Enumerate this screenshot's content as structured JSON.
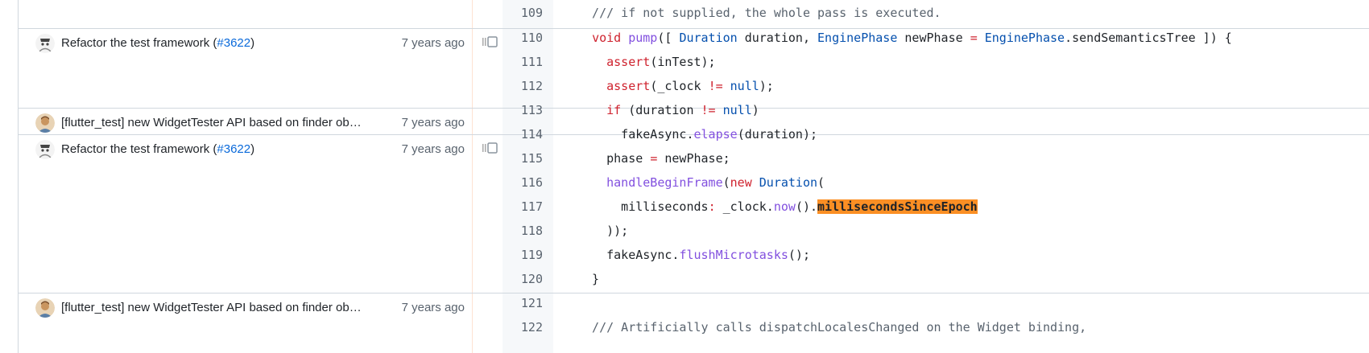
{
  "colors": {
    "keyword": "#cf222e",
    "type": "#0550ae",
    "function": "#8250df",
    "comment": "#59636e",
    "search_highlight": "#fb8f24",
    "link": "#0969da"
  },
  "blame": [
    {
      "message": "Refactor the test framework (",
      "pr": "#3622",
      "suffix": ")",
      "age": "7 years ago",
      "avatar": "ghost-avatar",
      "reblame": true
    },
    {
      "message": "[flutter_test] new WidgetTester API based on finder ob…",
      "pr": "",
      "suffix": "",
      "age": "7 years ago",
      "avatar": "person-avatar",
      "reblame": false
    },
    {
      "message": "Refactor the test framework (",
      "pr": "#3622",
      "suffix": ")",
      "age": "7 years ago",
      "avatar": "ghost-avatar",
      "reblame": true
    },
    {
      "message": "[flutter_test] new WidgetTester API based on finder ob…",
      "pr": "",
      "suffix": "",
      "age": "7 years ago",
      "avatar": "person-avatar",
      "reblame": false
    }
  ],
  "lines": [
    {
      "number": "109",
      "tokens": [
        [
          "  /// if not supplied, the whole pass is executed.",
          "cm"
        ]
      ]
    },
    {
      "number": "110",
      "tokens": [
        [
          "  ",
          ""
        ],
        [
          "void",
          "kw"
        ],
        [
          " ",
          ""
        ],
        [
          "pump",
          "fn"
        ],
        [
          "([ ",
          ""
        ],
        [
          "Duration",
          "ty"
        ],
        [
          " duration, ",
          ""
        ],
        [
          "EnginePhase",
          "ty"
        ],
        [
          " newPhase ",
          ""
        ],
        [
          "=",
          "kw"
        ],
        [
          " ",
          ""
        ],
        [
          "EnginePhase",
          "ty"
        ],
        [
          ".sendSemanticsTree ]) {",
          ""
        ]
      ]
    },
    {
      "number": "111",
      "tokens": [
        [
          "    ",
          ""
        ],
        [
          "assert",
          "kw"
        ],
        [
          "(inTest);",
          ""
        ]
      ]
    },
    {
      "number": "112",
      "tokens": [
        [
          "    ",
          ""
        ],
        [
          "assert",
          "kw"
        ],
        [
          "(_clock ",
          ""
        ],
        [
          "!=",
          "kw"
        ],
        [
          " ",
          ""
        ],
        [
          "null",
          "ty"
        ],
        [
          ");",
          ""
        ]
      ]
    },
    {
      "number": "113",
      "tokens": [
        [
          "    ",
          ""
        ],
        [
          "if",
          "kw"
        ],
        [
          " (duration ",
          ""
        ],
        [
          "!=",
          "kw"
        ],
        [
          " ",
          ""
        ],
        [
          "null",
          "ty"
        ],
        [
          ")",
          ""
        ]
      ]
    },
    {
      "number": "114",
      "tokens": [
        [
          "      fakeAsync.",
          ""
        ],
        [
          "elapse",
          "fn"
        ],
        [
          "(duration);",
          ""
        ]
      ]
    },
    {
      "number": "115",
      "tokens": [
        [
          "    phase ",
          ""
        ],
        [
          "=",
          "kw"
        ],
        [
          " newPhase;",
          ""
        ]
      ]
    },
    {
      "number": "116",
      "tokens": [
        [
          "    ",
          ""
        ],
        [
          "handleBeginFrame",
          "fn"
        ],
        [
          "(",
          ""
        ],
        [
          "new",
          "kw"
        ],
        [
          " ",
          ""
        ],
        [
          "Duration",
          "ty"
        ],
        [
          "(",
          ""
        ]
      ]
    },
    {
      "number": "117",
      "tokens": [
        [
          "      milliseconds",
          ""
        ],
        [
          ":",
          "kw"
        ],
        [
          " _clock.",
          ""
        ],
        [
          "now",
          "fn"
        ],
        [
          "().",
          ""
        ],
        [
          "millisecondsSinceEpoch",
          "hl"
        ]
      ]
    },
    {
      "number": "118",
      "tokens": [
        [
          "    ));",
          ""
        ]
      ]
    },
    {
      "number": "119",
      "tokens": [
        [
          "    fakeAsync.",
          ""
        ],
        [
          "flushMicrotasks",
          "fn"
        ],
        [
          "();",
          ""
        ]
      ]
    },
    {
      "number": "120",
      "tokens": [
        [
          "  }",
          ""
        ]
      ]
    },
    {
      "number": "121",
      "tokens": [
        [
          "",
          ""
        ]
      ]
    },
    {
      "number": "122",
      "tokens": [
        [
          "  /// Artificially calls dispatchLocalesChanged on the Widget binding,",
          "cm"
        ]
      ]
    }
  ]
}
